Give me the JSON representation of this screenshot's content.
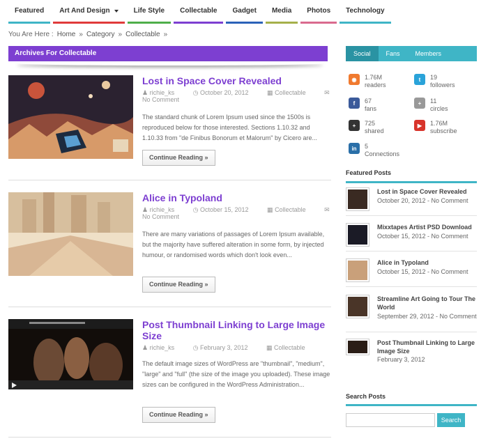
{
  "nav": {
    "items": [
      {
        "label": "Featured",
        "color": "#3fb5c6"
      },
      {
        "label": "Art And Design",
        "color": "#e03b3b",
        "dropdown": true
      },
      {
        "label": "Life Style",
        "color": "#4fae4a"
      },
      {
        "label": "Collectable",
        "color": "#7d3fd1"
      },
      {
        "label": "Gadget",
        "color": "#2b62b8"
      },
      {
        "label": "Media",
        "color": "#a5b04a"
      },
      {
        "label": "Photos",
        "color": "#d96a8e"
      },
      {
        "label": "Technology",
        "color": "#3fb5c6"
      }
    ]
  },
  "breadcrumb": {
    "prefix": "You Are Here :",
    "home": "Home",
    "sep": "»",
    "category": "Category",
    "current": "Collectable"
  },
  "archive_title": "Archives For Collectable",
  "posts": [
    {
      "title": "Lost in Space Cover Revealed",
      "author": "richie_ks",
      "date": "October 20, 2012",
      "category": "Collectable",
      "comments": "No Comment",
      "excerpt": "The standard chunk of Lorem Ipsum used since the 1500s is reproduced below for those interested. Sections 1.10.32 and 1.10.33 from \"de Finibus Bonorum et Malorum\" by Cicero are...",
      "button": "Continue Reading »"
    },
    {
      "title": "Alice in Typoland",
      "author": "richie_ks",
      "date": "October 15, 2012",
      "category": "Collectable",
      "comments": "No Comment",
      "excerpt": "There are many variations of passages of Lorem Ipsum available, but the majority have suffered alteration in some form, by injected humour, or randomised words which don't look even...",
      "button": "Continue Reading »"
    },
    {
      "title": "Post Thumbnail Linking to Large Image Size",
      "author": "richie_ks",
      "date": "February 3, 2012",
      "category": "Collectable",
      "excerpt": "The default image sizes of WordPress are \"thumbnail\", \"medium\", \"large\" and \"full\" (the size of the image you uploaded). These image sizes can be configured in the WordPress Administration...",
      "button": "Continue Reading »"
    }
  ],
  "sidebar": {
    "tabs": [
      {
        "label": "Social"
      },
      {
        "label": "Fans"
      },
      {
        "label": "Members"
      }
    ],
    "social": [
      {
        "icon": "rss-icon",
        "color": "#f07a2f",
        "glyph": "◉",
        "line1": "1.76M",
        "line2": "readers"
      },
      {
        "icon": "twitter-icon",
        "color": "#2aa3d9",
        "glyph": "t",
        "line1": "19",
        "line2": "followers"
      },
      {
        "icon": "facebook-icon",
        "color": "#3b5a9a",
        "glyph": "f",
        "line1": "67",
        "line2": "fans"
      },
      {
        "icon": "google-plus-icon",
        "color": "#999999",
        "glyph": "+",
        "line1": "11",
        "line2": "circles"
      },
      {
        "icon": "google-plus-share-icon",
        "color": "#333333",
        "glyph": "+",
        "line1": "725",
        "line2": "shared"
      },
      {
        "icon": "youtube-icon",
        "color": "#d8342b",
        "glyph": "▶",
        "line1": "1.76M",
        "line2": "subscribe"
      },
      {
        "icon": "linkedin-icon",
        "color": "#2a6fa8",
        "glyph": "in",
        "line1": "5",
        "line2": "Connections"
      }
    ],
    "featured_title": "Featured Posts",
    "featured": [
      {
        "title": "Lost in Space Cover Revealed",
        "meta": "October 20, 2012 - No Comment",
        "thumb": "#3a2a22"
      },
      {
        "title": "Mixxtapes Artist PSD Download",
        "meta": "October 15, 2012 - No Comment",
        "thumb": "#1b1b26"
      },
      {
        "title": "Alice in Typoland",
        "meta": "October 15, 2012 - No Comment",
        "thumb": "#c9a07a"
      },
      {
        "title": "Streamline Art Going to Tour The World",
        "meta": "September 29, 2012 - No Comment",
        "thumb": "#4a3528"
      },
      {
        "title": "Post Thumbnail Linking to Large Image Size",
        "meta": "February 3, 2012",
        "thumb": "#2a1d16"
      }
    ],
    "search_title": "Search Posts",
    "search_button": "Search",
    "search_placeholder": ""
  }
}
